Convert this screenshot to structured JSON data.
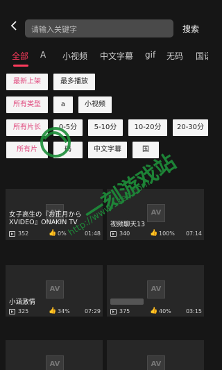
{
  "search": {
    "placeholder": "请输入关键字",
    "button": "搜索"
  },
  "tabs": [
    "全部",
    "A",
    "小视频",
    "中文字幕",
    "gif",
    "无码",
    "国语"
  ],
  "filters": {
    "sort": {
      "label": "最新上架",
      "options": [
        "最多播放"
      ]
    },
    "type": {
      "label": "所有类型",
      "options": [
        "a",
        "小视频"
      ]
    },
    "length": {
      "label": "所有片长",
      "options": [
        "0-5分",
        "5-10分",
        "10-20分",
        "20-30分"
      ]
    },
    "category": {
      "label": "所有片",
      "options": [
        "码",
        "中文字幕",
        "国"
      ]
    }
  },
  "videos": [
    {
      "title": "女子高生の『お正月から XVIDEO』ONAKIN TV",
      "views": "352",
      "likes": "0%",
      "duration": "01:48"
    },
    {
      "title": "视频聊天13",
      "views": "340",
      "likes": "100%",
      "duration": "07:14"
    },
    {
      "title": "小涵激情",
      "views": "325",
      "likes": "34%",
      "duration": "07:29"
    },
    {
      "title": "",
      "views": "375",
      "likes": "40%",
      "duration": "03:15"
    }
  ],
  "thumbnail_placeholder": "AV",
  "watermark": {
    "site": "一刻游戏站",
    "url": "http://www.1kec.com"
  },
  "colors": {
    "accent": "#ff3b5c",
    "chip_label": "#e0487d",
    "background": "#161616",
    "watermark": "#1e8f3a"
  }
}
